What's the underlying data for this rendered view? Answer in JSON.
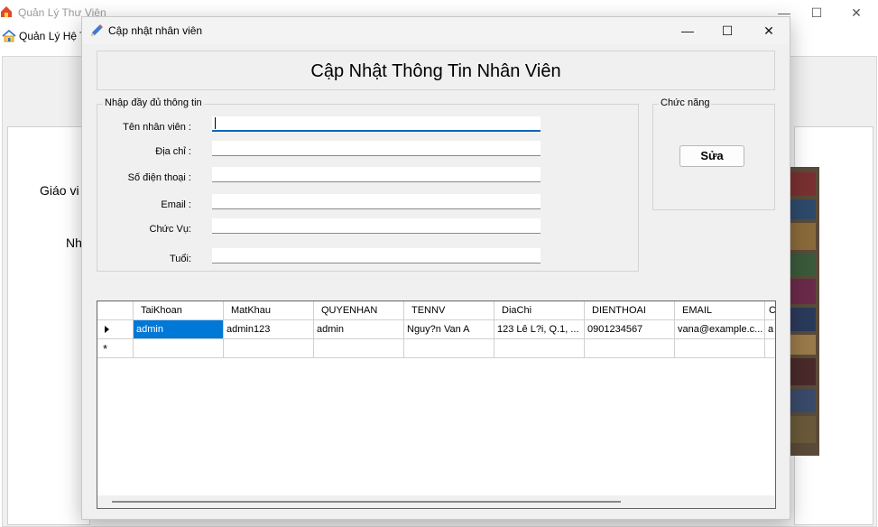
{
  "parent_window": {
    "title": "Quản Lý Thư Viện",
    "menu_item": "Quản Lý Hệ T",
    "label_1": "Giáo vi",
    "label_2": "Nh"
  },
  "dialog": {
    "title": "Cập nhật nhân viên",
    "header": "Cập Nhật Thông Tin Nhân Viên",
    "info_group_title": "Nhập đầy đủ thông tin",
    "function_group_title": "Chức năng",
    "edit_button": "Sửa",
    "fields": [
      {
        "label": "Tên nhân viên :",
        "value": ""
      },
      {
        "label": "Địa chỉ :",
        "value": ""
      },
      {
        "label": "Số điện thoại :",
        "value": ""
      },
      {
        "label": "Email :",
        "value": ""
      },
      {
        "label": "Chức Vụ:",
        "value": ""
      },
      {
        "label": "Tuổi:",
        "value": ""
      }
    ]
  },
  "grid": {
    "columns": [
      "TaiKhoan",
      "MatKhau",
      "QUYENHAN",
      "TENNV",
      "DiaChi",
      "DIENTHOAI",
      "EMAIL",
      "C"
    ],
    "rows": [
      [
        "admin",
        "admin123",
        "admin",
        "Nguy?n Van A",
        "123 Lê L?i, Q.1, ...",
        "0901234567",
        "vana@example.c...",
        "a"
      ]
    ],
    "new_row_marker": "*"
  },
  "colors": {
    "accent": "#0078d7",
    "focus_underline": "#0067c0",
    "window_bg": "#f0f0f0"
  }
}
